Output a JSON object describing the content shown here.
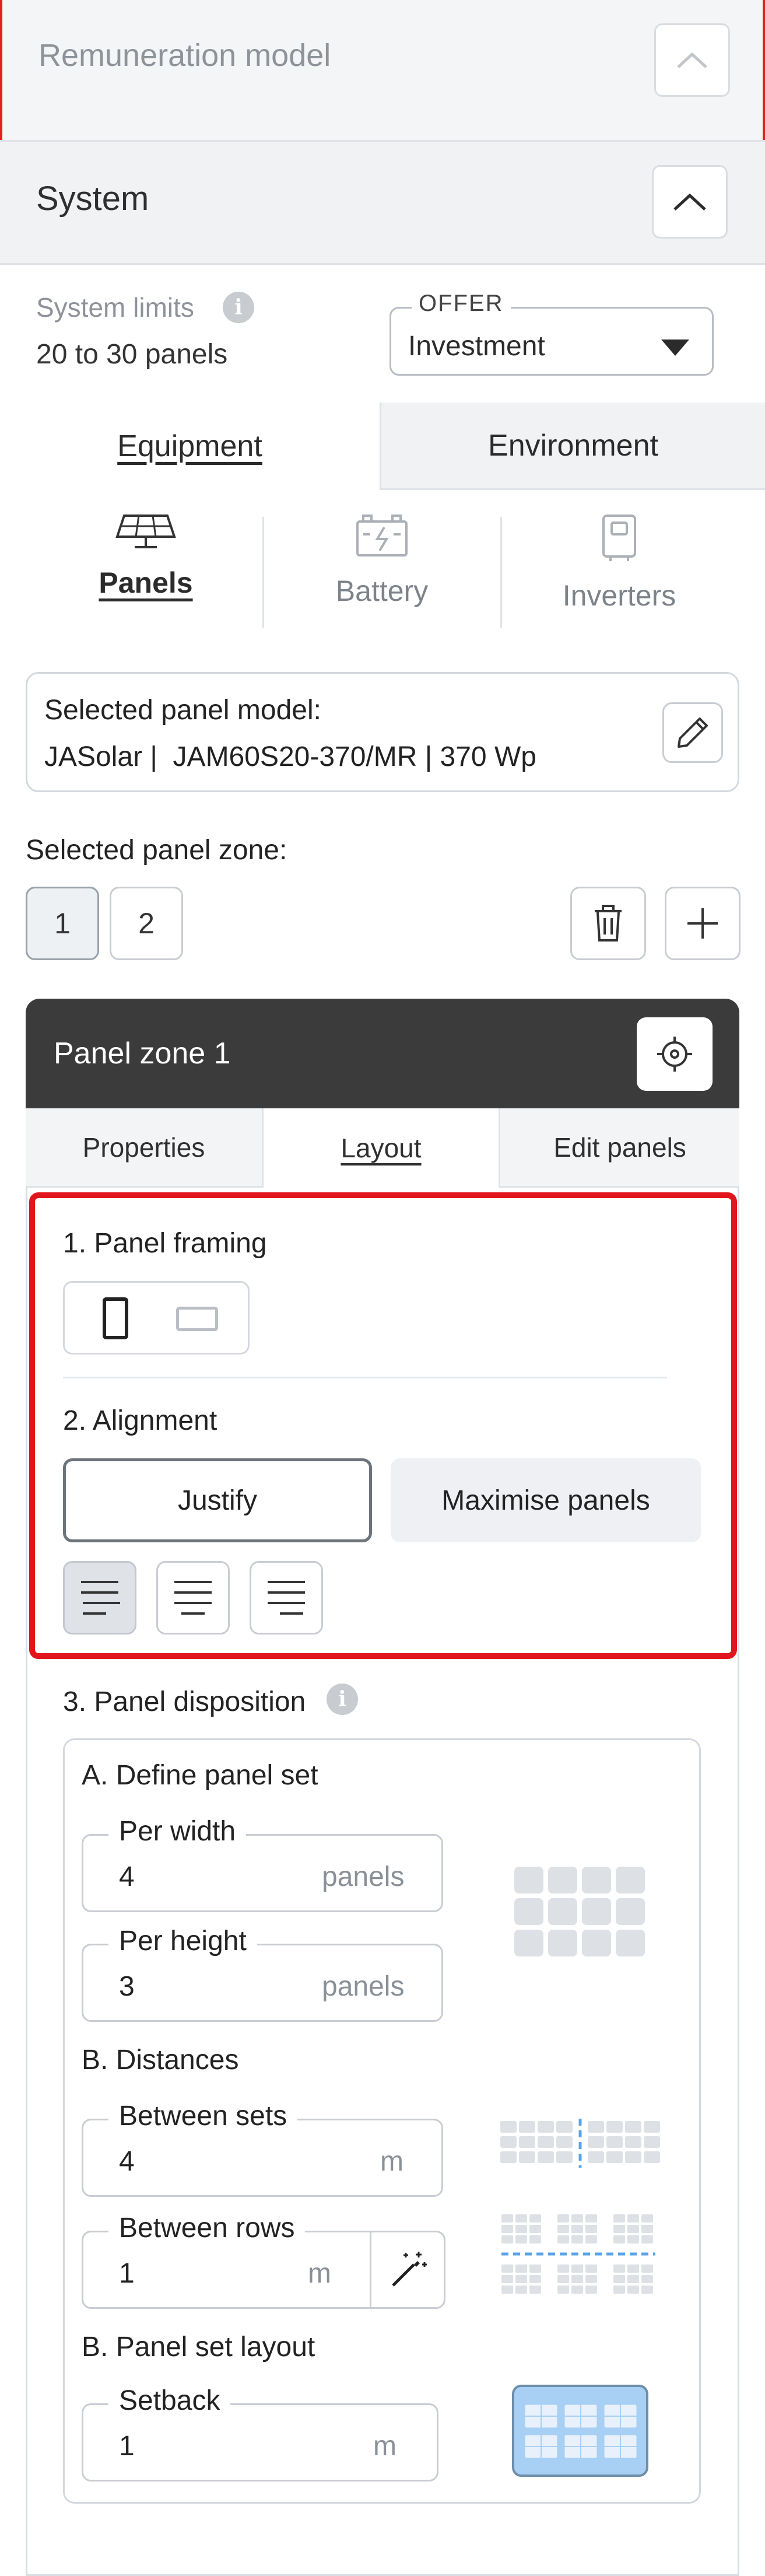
{
  "remuneration": {
    "title": "Remuneration model",
    "toggle_icon": "chevron-up-icon"
  },
  "system": {
    "title": "System",
    "toggle_icon": "chevron-up-icon",
    "limits_label": "System limits",
    "limits_value": "20 to 30 panels",
    "offer": {
      "legend": "OFFER",
      "value": "Investment"
    }
  },
  "tabs": {
    "equipment": "Equipment",
    "environment": "Environment",
    "active": "Equipment"
  },
  "equipment_tabs": [
    {
      "label": "Panels",
      "icon": "solar-panel-icon",
      "active": true
    },
    {
      "label": "Battery",
      "icon": "battery-icon",
      "active": false
    },
    {
      "label": "Inverters",
      "icon": "inverter-icon",
      "active": false
    }
  ],
  "panel_model": {
    "label": "Selected panel model:",
    "value": "JASolar |  JAM60S20-370/MR | 370 Wp"
  },
  "panel_zone": {
    "label": "Selected panel zone:",
    "zones": [
      "1",
      "2"
    ],
    "selected": "1"
  },
  "zone_card": {
    "title": "Panel zone 1",
    "tabs": {
      "properties": "Properties",
      "layout": "Layout",
      "edit_panels": "Edit panels",
      "active": "Layout"
    }
  },
  "layout": {
    "framing_title": "1. Panel framing",
    "alignment_title": "2. Alignment",
    "justify_label": "Justify",
    "maximise_label": "Maximise panels",
    "alignment_selected": "left"
  },
  "disposition": {
    "title": "3. Panel disposition",
    "define_set_title": "A. Define panel set",
    "per_width": {
      "label": "Per width",
      "value": "4",
      "unit": "panels"
    },
    "per_height": {
      "label": "Per height",
      "value": "3",
      "unit": "panels"
    },
    "distances_title": "B. Distances",
    "between_sets": {
      "label": "Between sets",
      "value": "4",
      "unit": "m"
    },
    "between_rows": {
      "label": "Between rows",
      "value": "1",
      "unit": "m"
    },
    "set_layout_title": "B. Panel set layout",
    "setback": {
      "label": "Setback",
      "value": "1",
      "unit": "m"
    }
  },
  "colors": {
    "accent_dark": "#3b3b3b",
    "highlight_red": "#e0161c",
    "setback_fill": "#a8cff4"
  }
}
